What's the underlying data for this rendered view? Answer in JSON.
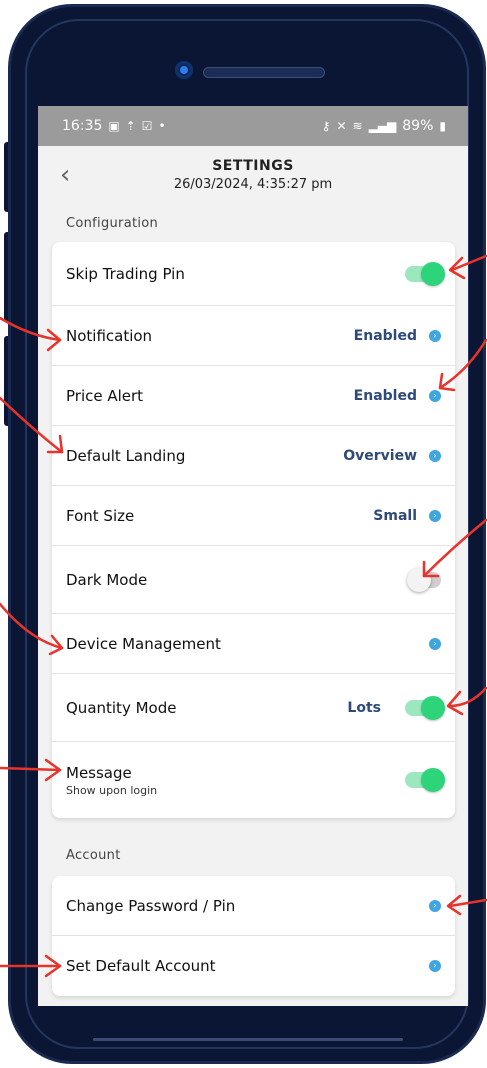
{
  "status_bar": {
    "time": "16:35",
    "battery": "89%",
    "left_icons": [
      "image-icon",
      "upload-icon",
      "check-box-icon",
      "dot-icon"
    ],
    "right_icons": [
      "key-icon",
      "mute-icon",
      "wifi-icon",
      "signal-icon",
      "battery-icon"
    ]
  },
  "header": {
    "title": "SETTINGS",
    "datetime": "26/03/2024, 4:35:27 pm",
    "back_icon": "chevron-left-icon"
  },
  "configuration": {
    "label": "Configuration",
    "rows": [
      {
        "label": "Skip Trading Pin",
        "toggle": true
      },
      {
        "label": "Notification",
        "value": "Enabled"
      },
      {
        "label": "Price Alert",
        "value": "Enabled"
      },
      {
        "label": "Default Landing",
        "value": "Overview"
      },
      {
        "label": "Font Size",
        "value": "Small"
      },
      {
        "label": "Dark Mode",
        "toggle": false
      },
      {
        "label": "Device Management"
      },
      {
        "label": "Quantity Mode",
        "value": "Lots",
        "toggle": true
      },
      {
        "label": "Message",
        "sublabel": "Show upon login",
        "toggle": true
      }
    ]
  },
  "account": {
    "label": "Account",
    "rows": [
      {
        "label": "Change Password / Pin"
      },
      {
        "label": "Set Default Account"
      }
    ]
  },
  "colors": {
    "toggle_on": "#2ed47a",
    "chevron": "#3fa6e0",
    "value_text": "#2e4a7a",
    "annotation_arrow": "#e8322c",
    "phone_frame": "#0a1633"
  }
}
